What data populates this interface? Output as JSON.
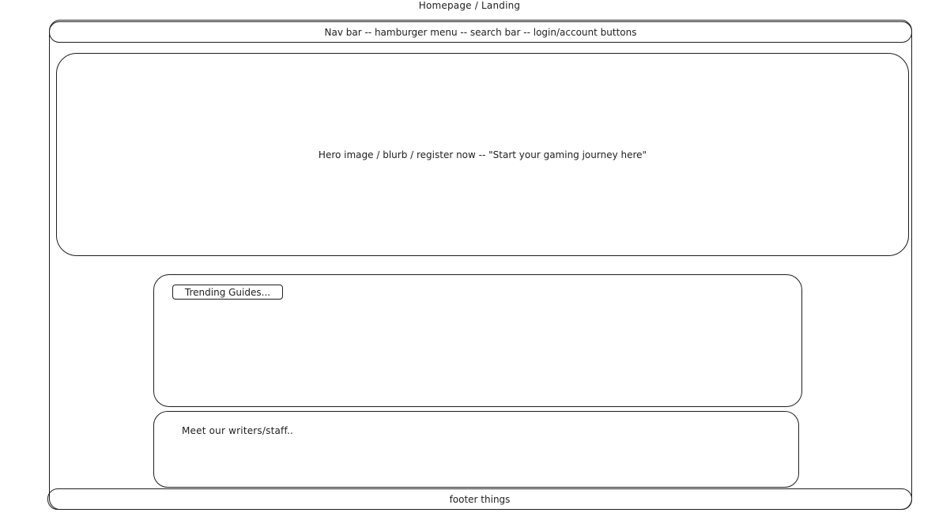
{
  "title": "Homepage / Landing",
  "nav": {
    "label": "Nav bar -- hamburger menu -- search bar -- login/account buttons"
  },
  "hero": {
    "label": "Hero image / blurb / register now -- \"Start your gaming journey here\""
  },
  "trending": {
    "label": "Trending Guides..."
  },
  "writers": {
    "label": "Meet our writers/staff.."
  },
  "footer": {
    "label": "footer things"
  }
}
